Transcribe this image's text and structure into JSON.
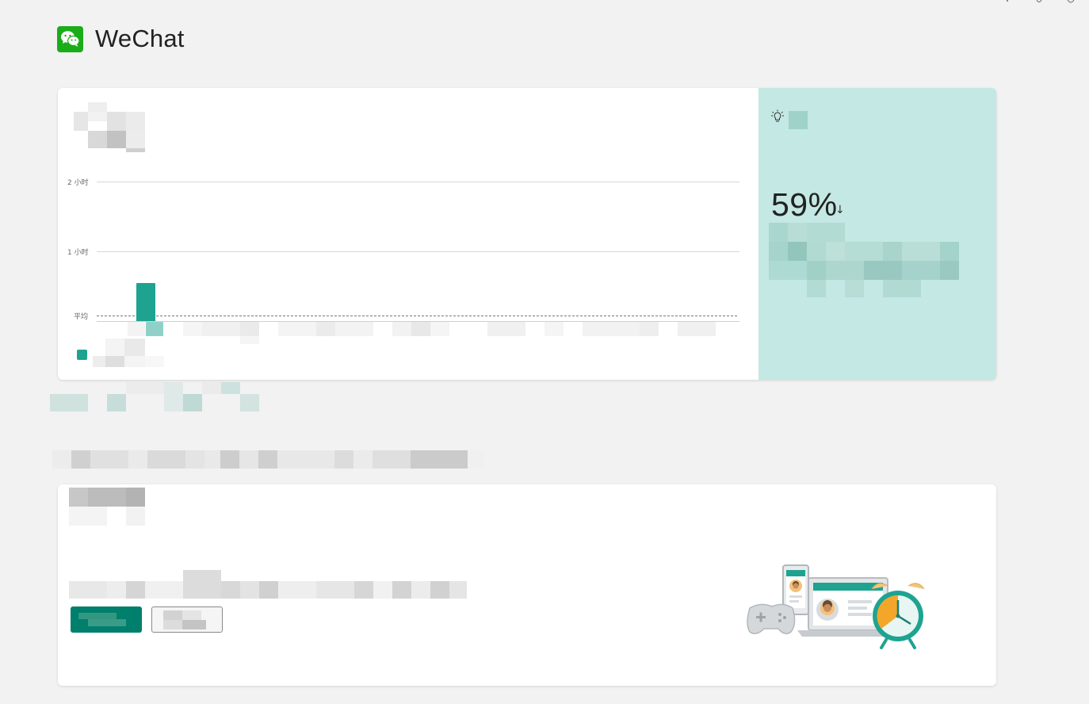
{
  "app": {
    "title": "WeChat",
    "logo_icon": "wechat-logo-icon"
  },
  "window_controls": [
    "minimize-icon",
    "restore-icon",
    "close-icon"
  ],
  "usage_chart": {
    "title": "",
    "legend_label": "",
    "avg_label": "平均",
    "chart_data": {
      "type": "bar",
      "title": "",
      "xlabel": "",
      "ylabel": "",
      "yticks": [
        "1 小时",
        "2 小时"
      ],
      "ylim_hours": [
        0,
        2
      ],
      "average_hours": 0.1,
      "categories": [],
      "series": [
        {
          "values": [
            0.55
          ]
        }
      ],
      "grid": true,
      "colors": {
        "bar": "#1fa391",
        "bar_light": "#8fd1c8"
      }
    }
  },
  "insight": {
    "icon": "lightbulb-icon",
    "value": "59%",
    "trend_arrow": "↓",
    "trend": "down",
    "background": "#c4e8e3"
  },
  "bottom_card": {
    "illustration_icon": "devices-and-alarm-clock-illustration",
    "primary_button_color": "#007f6d"
  }
}
